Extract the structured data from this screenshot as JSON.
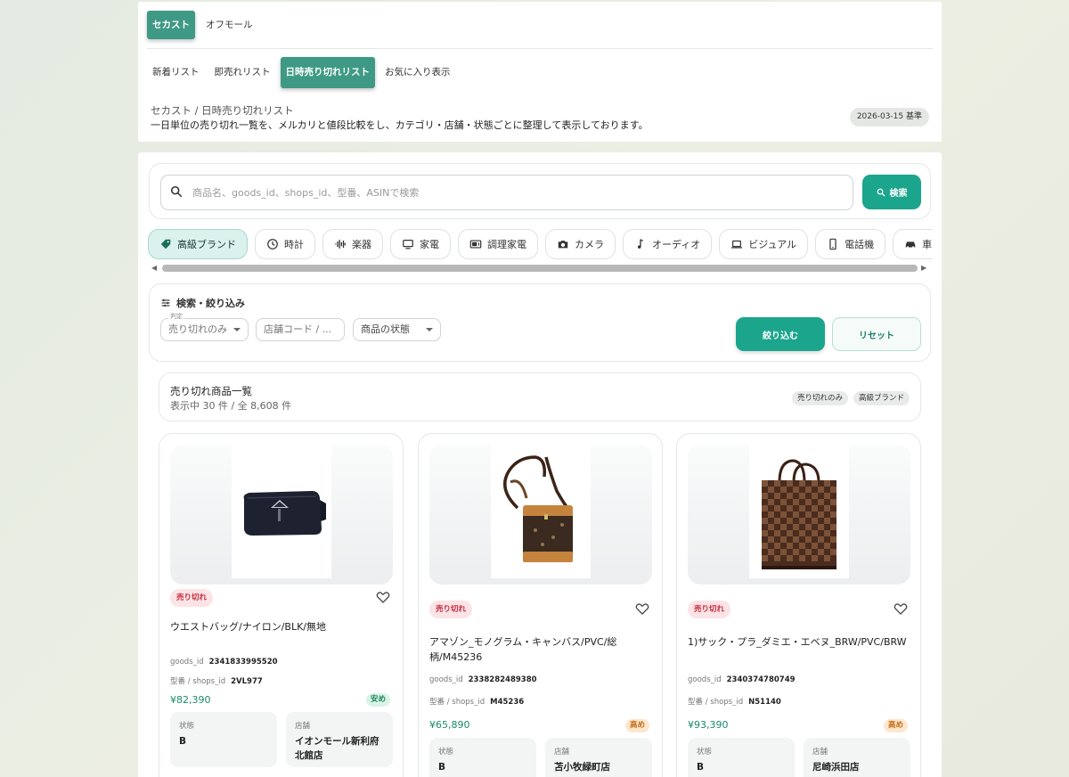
{
  "tabs_primary": [
    {
      "label": "セカスト",
      "active": true
    },
    {
      "label": "オフモール",
      "active": false
    }
  ],
  "tabs_secondary": [
    {
      "label": "新着リスト",
      "active": false
    },
    {
      "label": "即売れリスト",
      "active": false
    },
    {
      "label": "日時売り切れリスト",
      "active": true
    },
    {
      "label": "お気に入り表示",
      "active": false
    }
  ],
  "breadcrumb": "セカスト / 日時売り切れリスト",
  "description": "一日単位の売り切れ一覧を、メルカリと値段比較をし、カテゴリ・店舗・状態ごとに整理して表示しております。",
  "date_badge": "2026-03-15 基準",
  "search": {
    "placeholder": "商品名、goods_id、shops_id、型番、ASINで検索",
    "button_label": "検索"
  },
  "categories": [
    {
      "label": "高級ブランド",
      "icon": "tag-icon",
      "active": true
    },
    {
      "label": "時計",
      "icon": "clock-icon",
      "active": false
    },
    {
      "label": "楽器",
      "icon": "waveform-icon",
      "active": false
    },
    {
      "label": "家電",
      "icon": "monitor-icon",
      "active": false
    },
    {
      "label": "調理家電",
      "icon": "microwave-icon",
      "active": false
    },
    {
      "label": "カメラ",
      "icon": "camera-icon",
      "active": false
    },
    {
      "label": "オーディオ",
      "icon": "music-note-icon",
      "active": false
    },
    {
      "label": "ビジュアル",
      "icon": "laptop-icon",
      "active": false
    },
    {
      "label": "電話機",
      "icon": "phone-icon",
      "active": false
    },
    {
      "label": "車・バイク",
      "icon": "car-icon",
      "active": false
    }
  ],
  "filters": {
    "title": "検索・絞り込み",
    "judgement_label": "判定",
    "judgement_value": "売り切れのみ",
    "store_code_placeholder": "店舗コード / ...",
    "condition_placeholder": "商品の状態",
    "apply_label": "絞り込む",
    "reset_label": "リセット"
  },
  "list": {
    "title": "売り切れ商品一覧",
    "count": "表示中 30 件 / 全 8,608 件",
    "tags": [
      "売り切れのみ",
      "高級ブランド"
    ]
  },
  "products": [
    {
      "status": "売り切れ",
      "title": "ウエストバッグ/ナイロン/BLK/無地",
      "goods_id_label": "goods_id",
      "goods_id": "2341833995520",
      "model_label": "型番 / shops_id",
      "model": "2VL977",
      "price": "¥82,390",
      "price_badge": "安め",
      "price_badge_color": "green",
      "condition_label": "状態",
      "condition": "B",
      "store_label": "店舗",
      "store": "イオンモール新利府北館店",
      "image": "black-waist-bag"
    },
    {
      "status": "売り切れ",
      "title": "アマゾン_モノグラム・キャンバス/PVC/総柄/M45236",
      "goods_id_label": "goods_id",
      "goods_id": "2338282489380",
      "model_label": "型番 / shops_id",
      "model": "M45236",
      "price": "¥65,890",
      "price_badge": "高め",
      "price_badge_color": "orange",
      "condition_label": "状態",
      "condition": "B",
      "store_label": "店舗",
      "store": "苫小牧緑町店",
      "image": "monogram-crossbody"
    },
    {
      "status": "売り切れ",
      "title": "1)サック・プラ_ダミエ・エベヌ_BRW/PVC/BRW",
      "goods_id_label": "goods_id",
      "goods_id": "2340374780749",
      "model_label": "型番 / shops_id",
      "model": "N51140",
      "price": "¥93,390",
      "price_badge": "高め",
      "price_badge_color": "orange",
      "condition_label": "状態",
      "condition": "B",
      "store_label": "店舗",
      "store": "尼崎浜田店",
      "image": "damier-tote"
    }
  ],
  "colors": {
    "accent": "#1ba58c",
    "tab_active": "#3e9985",
    "sold_badge_bg": "#fbe3e6",
    "sold_badge_text": "#c5283a"
  }
}
